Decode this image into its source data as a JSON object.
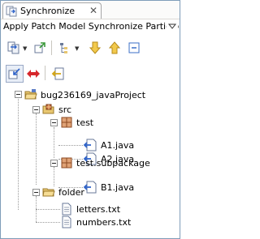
{
  "view": {
    "title": "Synchronize",
    "close_glyph": "✕",
    "description": "Apply Patch Model Synchronize Participar"
  },
  "toolbar": {
    "row1": [
      {
        "icon": "synchronize-icon",
        "dropdown": true
      },
      {
        "icon": "pin-icon"
      },
      {
        "icon": "layout-icon",
        "dropdown": true
      },
      {
        "icon": "arrow-down-icon"
      },
      {
        "icon": "arrow-up-icon"
      },
      {
        "icon": "collapse-all-icon"
      }
    ],
    "row2": [
      {
        "icon": "incoming-mode-icon",
        "pressed": true
      },
      {
        "icon": "conflicts-mode-icon"
      },
      {
        "icon": "outgoing-mode-icon"
      }
    ]
  },
  "tree": [
    {
      "label": "bug236169_javaProject",
      "icon": "project-folder-icon"
    },
    {
      "label": "src",
      "icon": "package-folder-icon"
    },
    {
      "label": "test",
      "icon": "package-icon"
    },
    {
      "label": "A1.java",
      "icon": "java-file-icon"
    },
    {
      "label": "A2.java",
      "icon": "java-file-icon"
    },
    {
      "label": "test.subpackage",
      "icon": "package-icon"
    },
    {
      "label": "B1.java",
      "icon": "java-file-icon"
    },
    {
      "label": "folder",
      "icon": "folder-icon"
    },
    {
      "label": "letters.txt",
      "icon": "text-file-icon"
    },
    {
      "label": "numbers.txt",
      "icon": "text-file-icon"
    }
  ],
  "colors": {
    "accent": "#3b6fc7",
    "folder": "#e8c770",
    "package": "#c86b3c",
    "incoming": "#2f63c9",
    "conflict": "#d6262b"
  }
}
